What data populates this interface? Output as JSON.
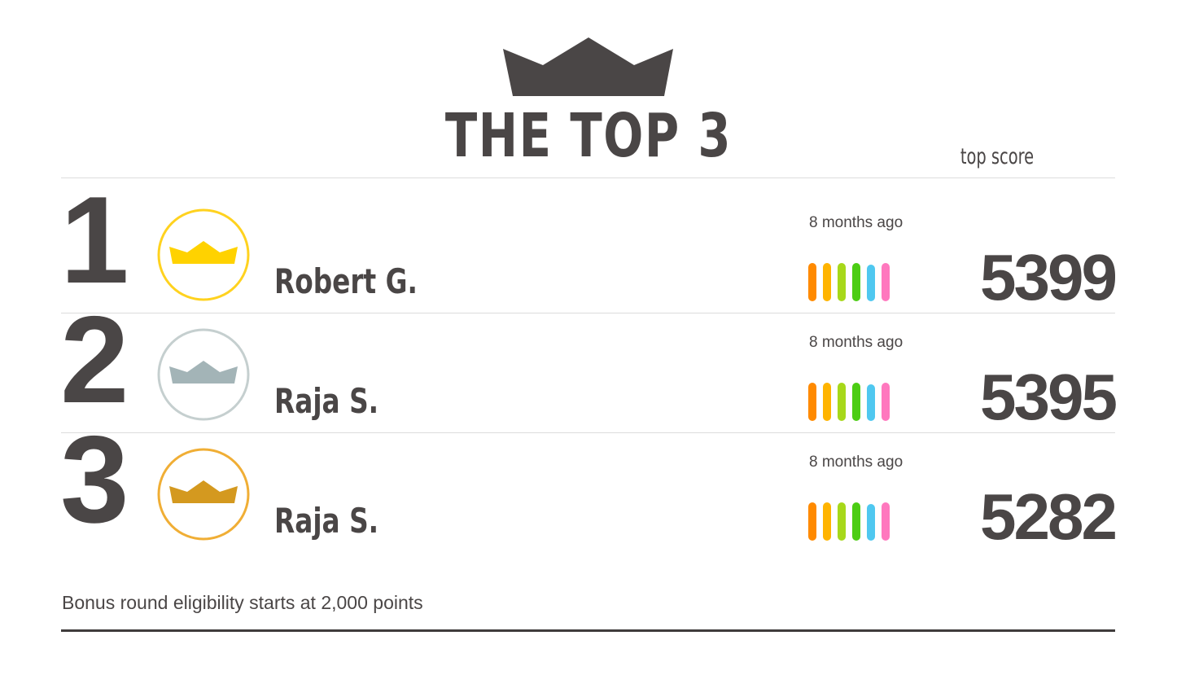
{
  "header": {
    "logo_icon": "crown-icon",
    "logo_color": "#4a4646",
    "title": "THE TOP 3",
    "top_score_label": "top score"
  },
  "leaderboard": [
    {
      "rank": "1",
      "badge_icon": "crown-icon",
      "badge_color": "#ffd200",
      "badge_ring_color": "#ffd21f",
      "name": "Robert G.",
      "time_ago": "8 months ago",
      "score": "5399"
    },
    {
      "rank": "2",
      "badge_icon": "crown-icon",
      "badge_color": "#a3b4b7",
      "badge_ring_color": "#c5cfcf",
      "name": "Raja S.",
      "time_ago": "8 months ago",
      "score": "5395"
    },
    {
      "rank": "3",
      "badge_icon": "crown-icon",
      "badge_color": "#d4991f",
      "badge_ring_color": "#f0ae35",
      "name": "Raja S.",
      "time_ago": "8 months ago",
      "score": "5282"
    }
  ],
  "activity_bar_colors": [
    "#ff8a00",
    "#ffb400",
    "#a7d81a",
    "#4ccd14",
    "#4fc8f0",
    "#ff78be"
  ],
  "footer": {
    "note": "Bonus round eligibility starts at 2,000 points"
  }
}
